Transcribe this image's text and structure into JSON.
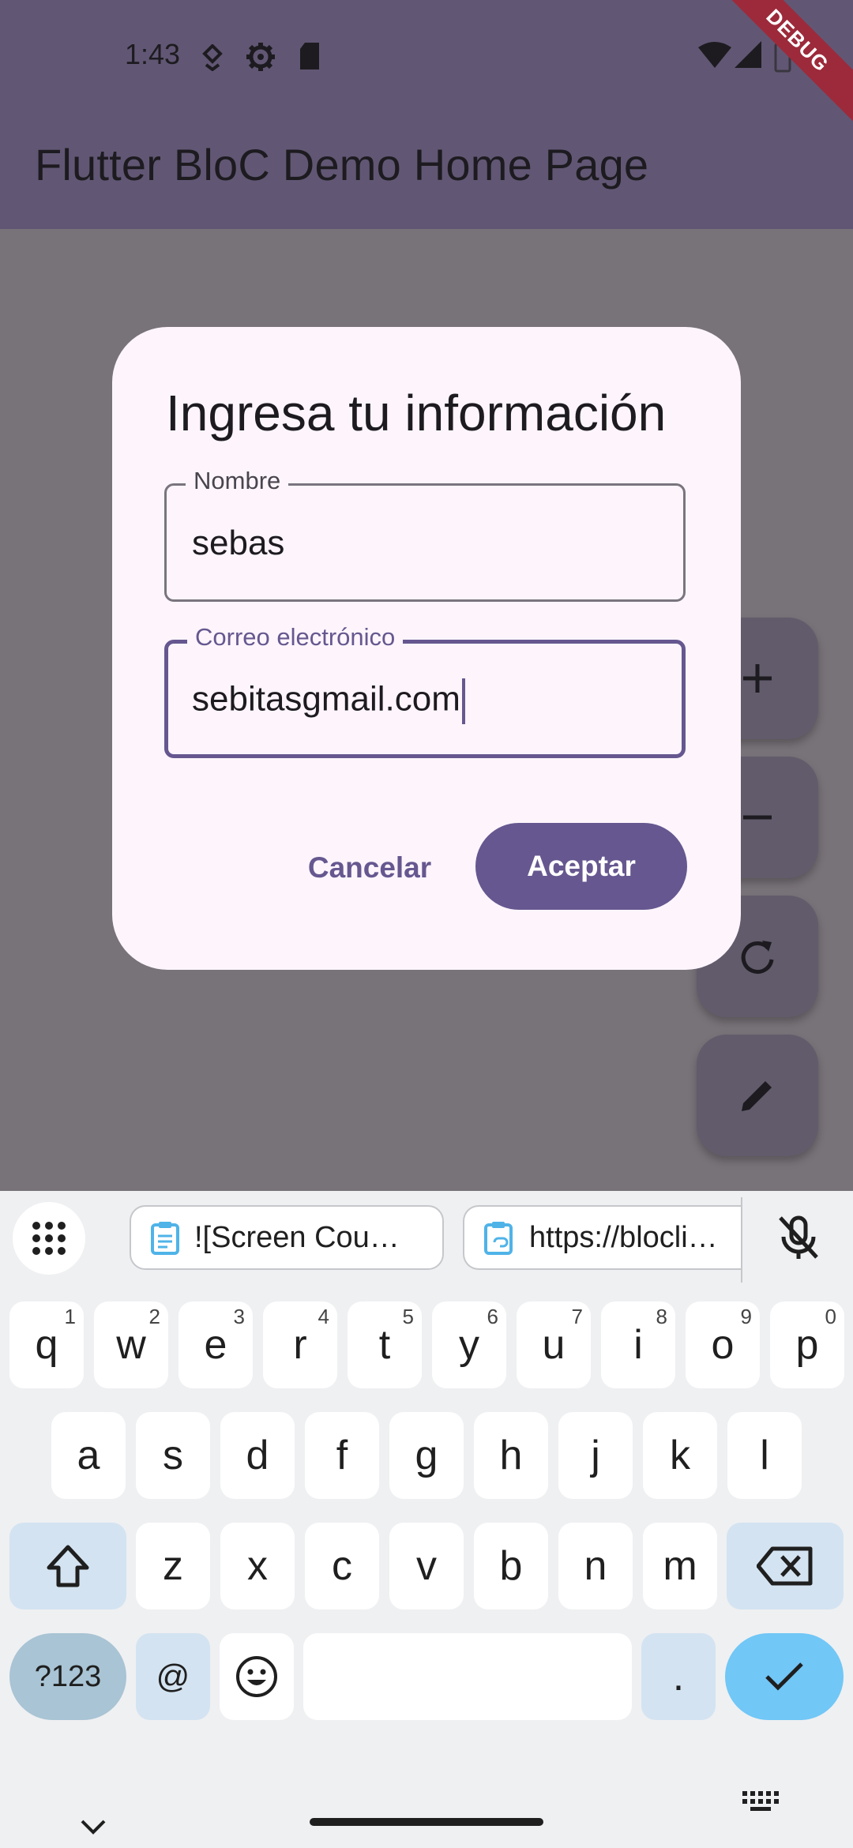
{
  "status_bar": {
    "time": "1:43",
    "icons": [
      "location-pin-icon",
      "settings-gear-icon",
      "sd-card-icon",
      "wifi-icon",
      "signal-icon",
      "battery-icon"
    ]
  },
  "app_bar": {
    "title": "Flutter BloC Demo Home Page",
    "debug_banner": "DEBUG",
    "color": "#615774"
  },
  "fabs": [
    "plus-icon",
    "minus-icon",
    "refresh-icon",
    "edit-pencil-icon"
  ],
  "dialog": {
    "title": "Ingresa tu información",
    "name_field": {
      "label": "Nombre",
      "value": "sebas"
    },
    "email_field": {
      "label": "Correo electrónico",
      "value": "sebitasgmail.com"
    },
    "cancel_label": "Cancelar",
    "accept_label": "Aceptar",
    "accent": "#665790"
  },
  "keyboard": {
    "clipboard_chips": [
      "![Screen Cou…",
      "https://blocli…"
    ],
    "row1": [
      {
        "k": "q",
        "n": "1"
      },
      {
        "k": "w",
        "n": "2"
      },
      {
        "k": "e",
        "n": "3"
      },
      {
        "k": "r",
        "n": "4"
      },
      {
        "k": "t",
        "n": "5"
      },
      {
        "k": "y",
        "n": "6"
      },
      {
        "k": "u",
        "n": "7"
      },
      {
        "k": "i",
        "n": "8"
      },
      {
        "k": "o",
        "n": "9"
      },
      {
        "k": "p",
        "n": "0"
      }
    ],
    "row2": [
      "a",
      "s",
      "d",
      "f",
      "g",
      "h",
      "j",
      "k",
      "l"
    ],
    "row3": [
      "z",
      "x",
      "c",
      "v",
      "b",
      "n",
      "m"
    ],
    "numbers_key": "?123",
    "at_key": "@",
    "period_key": ".",
    "enter_color": "#71c7f6"
  }
}
